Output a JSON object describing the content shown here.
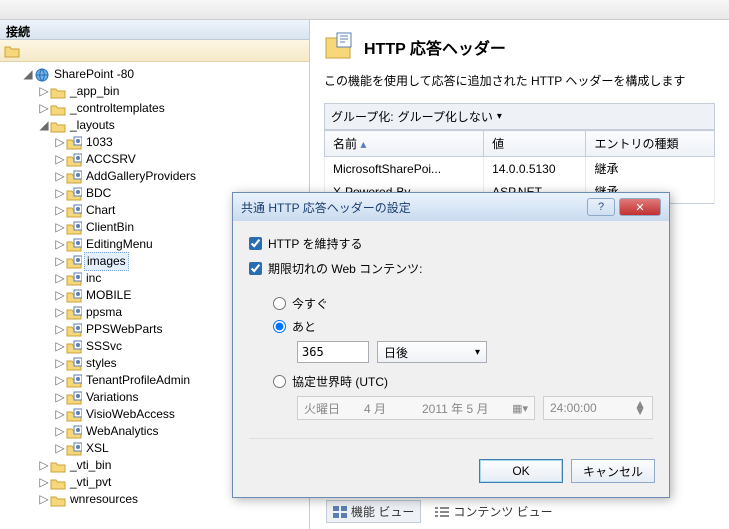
{
  "tree_header": "接続",
  "root_node": "SharePoint -80",
  "nodes": [
    {
      "indent": 1,
      "tw": "▷",
      "icon": "folder",
      "label": "_app_bin"
    },
    {
      "indent": 1,
      "tw": "▷",
      "icon": "folder",
      "label": "_controltemplates"
    },
    {
      "indent": 1,
      "tw": "◢",
      "icon": "folder",
      "label": "_layouts"
    },
    {
      "indent": 2,
      "tw": "▷",
      "icon": "folder-app",
      "label": "1033"
    },
    {
      "indent": 2,
      "tw": "▷",
      "icon": "folder-app",
      "label": "ACCSRV"
    },
    {
      "indent": 2,
      "tw": "▷",
      "icon": "folder-app",
      "label": "AddGalleryProviders"
    },
    {
      "indent": 2,
      "tw": "▷",
      "icon": "folder-app",
      "label": "BDC"
    },
    {
      "indent": 2,
      "tw": "▷",
      "icon": "folder-app",
      "label": "Chart"
    },
    {
      "indent": 2,
      "tw": "▷",
      "icon": "folder-app",
      "label": "ClientBin"
    },
    {
      "indent": 2,
      "tw": "▷",
      "icon": "folder-app",
      "label": "EditingMenu"
    },
    {
      "indent": 2,
      "tw": "▷",
      "icon": "folder-app",
      "label": "images",
      "selected": true
    },
    {
      "indent": 2,
      "tw": "▷",
      "icon": "folder-app",
      "label": "inc"
    },
    {
      "indent": 2,
      "tw": "▷",
      "icon": "folder-app",
      "label": "MOBILE"
    },
    {
      "indent": 2,
      "tw": "▷",
      "icon": "folder-app",
      "label": "ppsma"
    },
    {
      "indent": 2,
      "tw": "▷",
      "icon": "folder-app",
      "label": "PPSWebParts"
    },
    {
      "indent": 2,
      "tw": "▷",
      "icon": "folder-app",
      "label": "SSSvc"
    },
    {
      "indent": 2,
      "tw": "▷",
      "icon": "folder-app",
      "label": "styles"
    },
    {
      "indent": 2,
      "tw": "▷",
      "icon": "folder-app",
      "label": "TenantProfileAdmin"
    },
    {
      "indent": 2,
      "tw": "▷",
      "icon": "folder-app",
      "label": "Variations"
    },
    {
      "indent": 2,
      "tw": "▷",
      "icon": "folder-app",
      "label": "VisioWebAccess"
    },
    {
      "indent": 2,
      "tw": "▷",
      "icon": "folder-app",
      "label": "WebAnalytics"
    },
    {
      "indent": 2,
      "tw": "▷",
      "icon": "folder-app",
      "label": "XSL"
    },
    {
      "indent": 1,
      "tw": "▷",
      "icon": "folder",
      "label": "_vti_bin"
    },
    {
      "indent": 1,
      "tw": "▷",
      "icon": "folder",
      "label": "_vti_pvt"
    },
    {
      "indent": 1,
      "tw": "▷",
      "icon": "folder",
      "label": "wnresources"
    }
  ],
  "page": {
    "title": "HTTP 応答ヘッダー",
    "desc": "この機能を使用して応答に追加された HTTP ヘッダーを構成します",
    "group_label": "グループ化:",
    "group_value": "グループ化しない"
  },
  "table": {
    "cols": [
      "名前",
      "値",
      "エントリの種類"
    ],
    "rows": [
      [
        "MicrosoftSharePoi...",
        "14.0.0.5130",
        "継承"
      ],
      [
        "X-Powered-By",
        "ASP.NET",
        "継承"
      ]
    ]
  },
  "dialog": {
    "title": "共通 HTTP 応答ヘッダーの設定",
    "chk_keep": "HTTP を維持する",
    "chk_expire": "期限切れの Web コンテンツ:",
    "radio_now": "今すぐ",
    "radio_after": "あと",
    "after_value": "365",
    "after_unit": "日後",
    "radio_utc": "協定世界時 (UTC)",
    "date_value": "火曜日　　4 月　　　2011 年 5 月",
    "time_value": "24:00:00",
    "ok": "OK",
    "cancel": "キャンセル"
  },
  "tabs": {
    "features": "機能 ビュー",
    "content": "コンテンツ ビュー"
  }
}
